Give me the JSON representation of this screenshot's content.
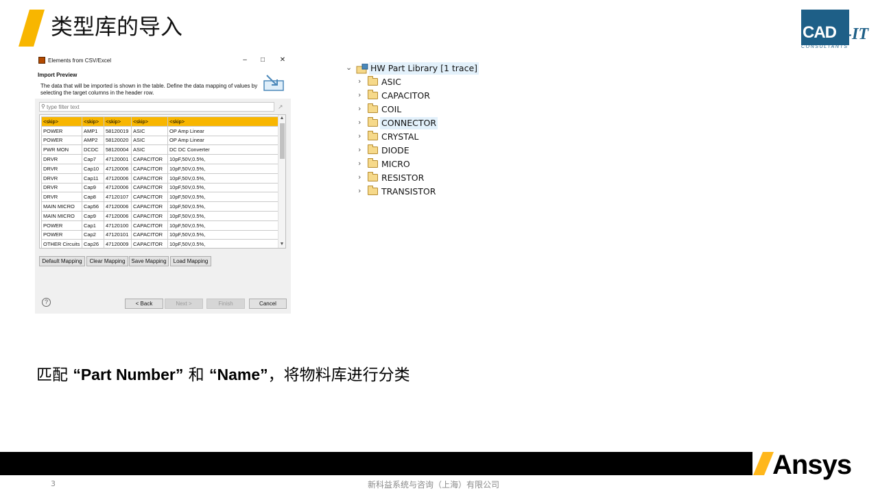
{
  "slide": {
    "title": "类型库的导入",
    "accent_color": "#f8b600",
    "logo_main": "CAD",
    "logo_it": "-IT",
    "logo_sub": "CONSULTANTS",
    "caption_prefix": "匹配",
    "caption_part_number": "“Part Number”",
    "caption_and": "和",
    "caption_name": "“Name”",
    "caption_suffix": "，将物料库进行分类",
    "page_number": "3",
    "footer_company": "新科益系统与咨询（上海）有限公司",
    "brand": "Ansys"
  },
  "dialog": {
    "title": "Elements from CSV/Excel",
    "minimize": "–",
    "maximize": "□",
    "close": "✕",
    "heading": "Import Preview",
    "description": "The data that will be imported is shown in the table. Define the data mapping of values by selecting the target columns in the header row.",
    "filter_placeholder": "type filter text",
    "filter_icon": "search-icon",
    "table": {
      "headers": [
        "<skip>",
        "<skip>",
        "<skip>",
        "<skip>",
        "<skip>"
      ],
      "rows": [
        [
          "POWER",
          "AMP1",
          "58120019",
          "ASIC",
          "OP Amp Linear"
        ],
        [
          "POWER",
          "AMP2",
          "58120020",
          "ASIC",
          "OP Amp Linear"
        ],
        [
          "PWR MON",
          "DCDC",
          "58120004",
          "ASIC",
          "DC DC Converter"
        ],
        [
          "DRVR",
          "Cap7",
          "47120001",
          "CAPACITOR",
          "10pF,50V,0.5%,"
        ],
        [
          "DRVR",
          "Cap10",
          "47120006",
          "CAPACITOR",
          "10pF,50V,0.5%,"
        ],
        [
          "DRVR",
          "Cap11",
          "47120006",
          "CAPACITOR",
          "10pF,50V,0.5%,"
        ],
        [
          "DRVR",
          "Cap9",
          "47120006",
          "CAPACITOR",
          "10pF,50V,0.5%,"
        ],
        [
          "DRVR",
          "Cap8",
          "47120107",
          "CAPACITOR",
          "10pF,50V,0.5%,"
        ],
        [
          "MAIN MICRO",
          "Cap56",
          "47120006",
          "CAPACITOR",
          "10pF,50V,0.5%,"
        ],
        [
          "MAIN MICRO",
          "Cap9",
          "47120006",
          "CAPACITOR",
          "10pF,50V,0.5%,"
        ],
        [
          "POWER",
          "Cap1",
          "47120100",
          "CAPACITOR",
          "10pF,50V,0.5%,"
        ],
        [
          "POWER",
          "Cap2",
          "47120101",
          "CAPACITOR",
          "10pF,50V,0.5%,"
        ],
        [
          "OTHER Circuits",
          "Cap26",
          "47120009",
          "CAPACITOR",
          "10pF,50V,0.5%,"
        ]
      ]
    },
    "buttons": {
      "default_mapping": "Default Mapping",
      "clear_mapping": "Clear Mapping",
      "save_mapping": "Save Mapping",
      "load_mapping": "Load Mapping",
      "back": "< Back",
      "next": "Next >",
      "finish": "Finish",
      "cancel": "Cancel",
      "help": "?"
    }
  },
  "tree": {
    "root": "HW Part Library [1 trace]",
    "items": [
      "ASIC",
      "CAPACITOR",
      "COIL",
      "CONNECTOR",
      "CRYSTAL",
      "DIODE",
      "MICRO",
      "RESISTOR",
      "TRANSISTOR"
    ],
    "selected": "CONNECTOR"
  }
}
